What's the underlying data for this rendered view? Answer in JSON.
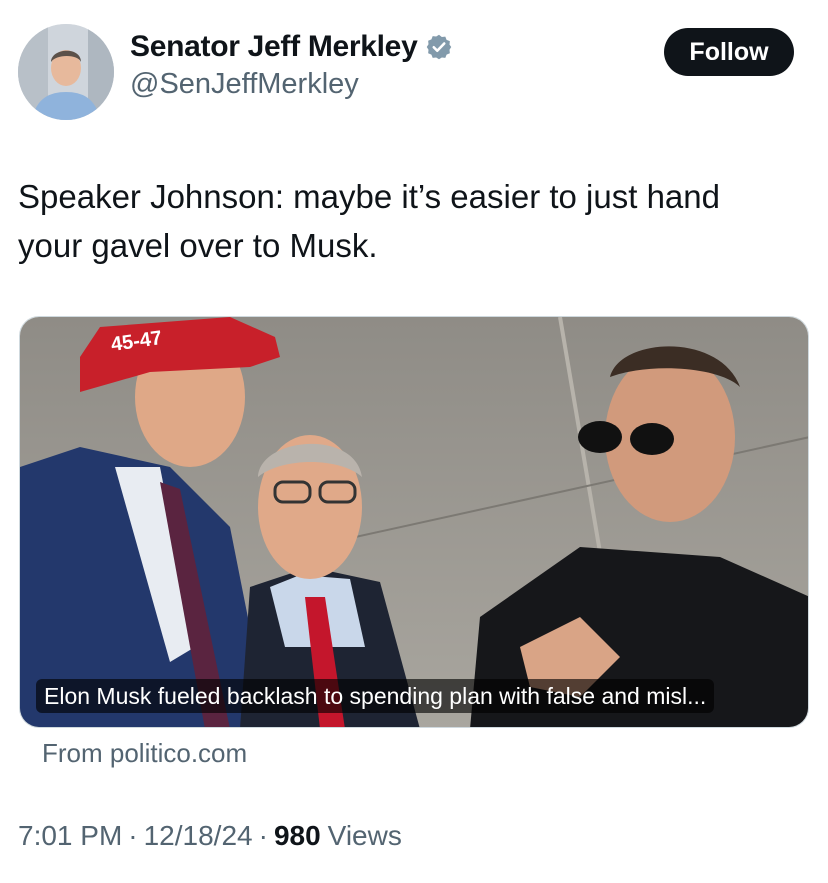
{
  "author": {
    "display_name": "Senator Jeff Merkley",
    "handle": "@SenJeffMerkley",
    "verified_icon": "verified-badge-icon"
  },
  "actions": {
    "follow_label": "Follow"
  },
  "tweet": {
    "text_line1": "Speaker Johnson: maybe it’s easier to just hand",
    "text_line2": "your gavel over to Musk."
  },
  "card": {
    "caption": "Elon Musk fueled backlash to spending plan with false and misl...",
    "source": "From politico.com",
    "hat_text": "45-47"
  },
  "meta": {
    "time": "7:01 PM",
    "separator": "·",
    "date": "12/18/24",
    "views_count": "980",
    "views_label": "Views"
  },
  "colors": {
    "text_primary": "#0f1419",
    "text_secondary": "#536471",
    "verified_gray": "#829aab",
    "follow_bg": "#0f1419"
  }
}
